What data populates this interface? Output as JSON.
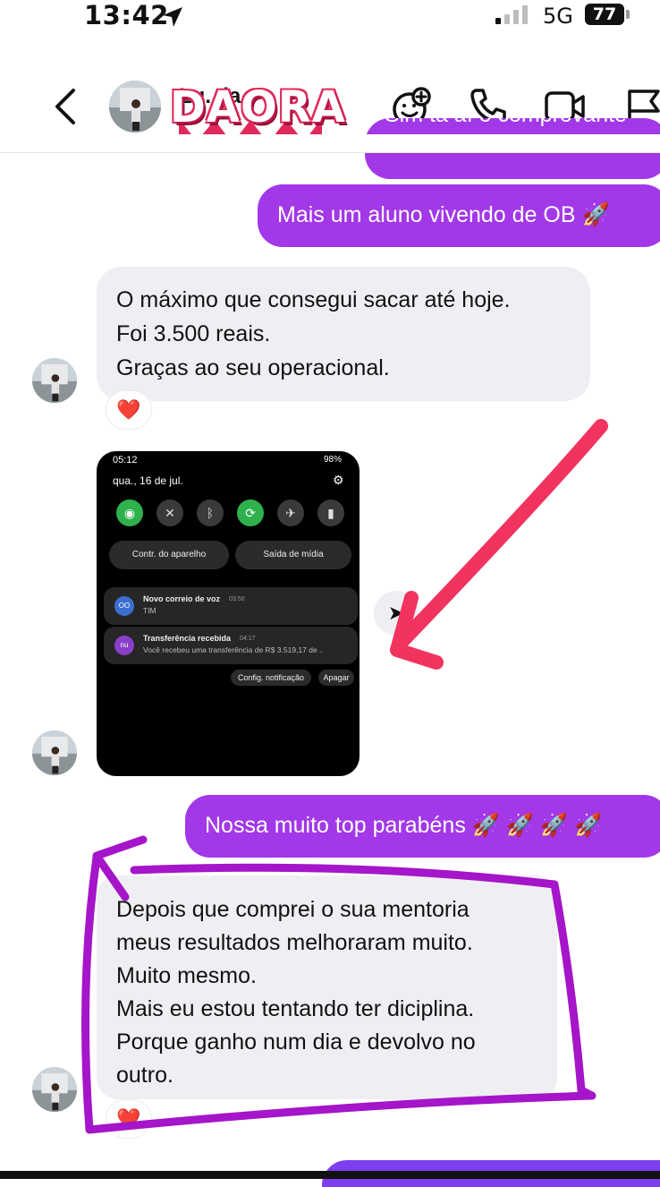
{
  "status_bar": {
    "time": "13:42",
    "network": "5G",
    "battery": "77"
  },
  "header": {
    "contact_name": "Lu...ia",
    "sticker_text": "DAORA"
  },
  "messages": {
    "out_cropped": "Sim tá aí o comprovante",
    "out_1": "Mais um aluno vivendo de OB 🚀",
    "in_1": {
      "lines": [
        "O máximo que consegui sacar até hoje.",
        "Foi 3.500 reais.",
        "Graças ao seu operacional."
      ],
      "reaction": "❤️"
    },
    "out_2": "Nossa muito top parabéns 🚀 🚀 🚀 🚀",
    "in_2": {
      "lines": [
        "Depois que comprei o sua mentoria",
        "meus resultados melhoraram muito.",
        "Muito mesmo.",
        "Mais eu estou tentando ter diciplina.",
        "Porque ganho num dia e devolvo no",
        "outro."
      ],
      "reaction": "❤️"
    }
  },
  "shared_screenshot": {
    "time": "05:12",
    "battery": "98%",
    "date": "qua., 16 de jul.",
    "buttons": {
      "device_control": "Contr. do aparelho",
      "media_output": "Saída de mídia"
    },
    "notifications": [
      {
        "title": "Novo correio de voz",
        "time": "03:50",
        "body": "TIM",
        "icon_text": "OO"
      },
      {
        "title": "Transferência recebida",
        "time": "04:17",
        "body": "Você recebeu uma transferência de R$ 3.519,17 de ..",
        "icon_text": "nu"
      }
    ],
    "actions": {
      "settings": "Config. notificação",
      "clear": "Apagar"
    }
  },
  "colors": {
    "outgoing_bubble": "#a238e8",
    "incoming_bubble": "#efeff3",
    "arrow_pink": "#f2335f",
    "marker_purple": "#a515c9"
  }
}
